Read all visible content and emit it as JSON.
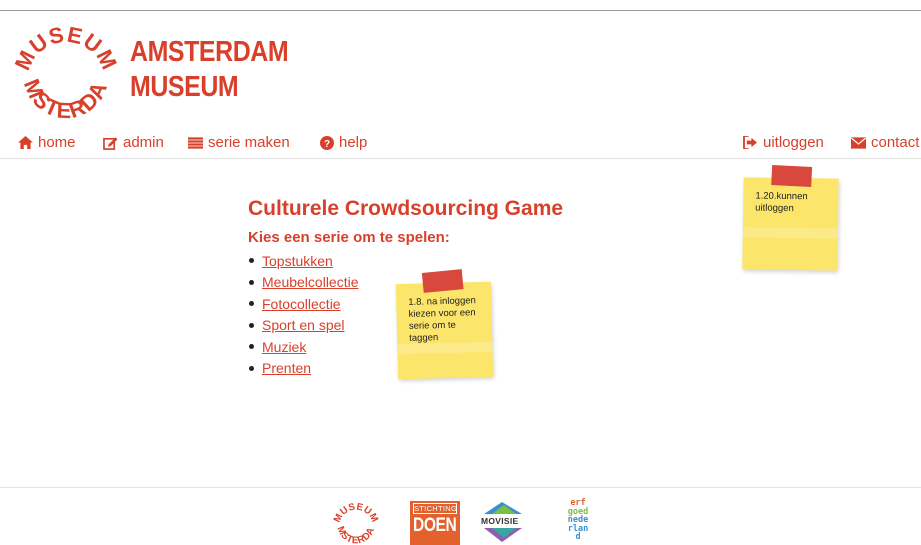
{
  "logo": {
    "seal_text": "MUSEUM AMSTERDAM",
    "line1": "AMSTERDAM",
    "line2": "MUSEUM"
  },
  "nav": {
    "home": {
      "label": "home",
      "icon": "home-icon"
    },
    "admin": {
      "label": "admin",
      "icon": "edit-icon"
    },
    "serie_maken": {
      "label": "serie maken",
      "icon": "list-icon"
    },
    "help": {
      "label": "help",
      "icon": "help-icon"
    },
    "uitloggen": {
      "label": "uitloggen",
      "icon": "logout-icon"
    },
    "contact": {
      "label": "contact",
      "icon": "envelope-icon"
    }
  },
  "main": {
    "title": "Culturele Crowdsourcing Game",
    "subtitle": "Kies een serie om te spelen:",
    "series": [
      "Topstukken",
      "Meubelcollectie",
      "Fotocollectie",
      "Sport en spel",
      "Muziek",
      "Prenten"
    ]
  },
  "notes": {
    "note1": "1.8. na inloggen kiezen voor een serie om te taggen",
    "note2": "1.20.kunnen uitloggen"
  },
  "footer": {
    "doen_top": "STICHTING",
    "doen_big": "DOEN",
    "movisie": "MOVISIE",
    "erfgoed": [
      "erf",
      "goed",
      "nede",
      "rlan",
      "d"
    ]
  },
  "colors": {
    "brand_red": "#d9402b",
    "note_yellow": "#fbe56a",
    "tape_red": "#d9483d",
    "doen_orange": "#e2612c"
  }
}
